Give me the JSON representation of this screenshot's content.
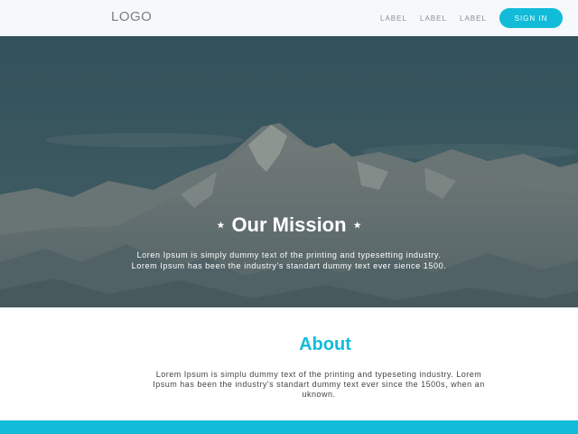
{
  "header": {
    "logo": "LOGO",
    "nav": [
      "LABEL",
      "LABEL",
      "LABEL"
    ],
    "signin_label": "SIGN IN"
  },
  "hero": {
    "title": "Our Mission",
    "star_glyph": "★",
    "text_line1": "Loren Ipsum is simply dummy text of the printing and typesetting industry.",
    "text_line2": "Lorem Ipsum has been the industry's standart dummy text ever sience 1500."
  },
  "about": {
    "title": "About",
    "text": "Lorem Ipsum is simplu dummy text of the printing and typeseting industry. Lorem Ipsum has been the industry's standart dummy text ever since the 1500s, when an uknown."
  },
  "colors": {
    "accent": "#12bcd9",
    "navbar_bg": "#f5f9fc",
    "hero_overlay": "#38555f"
  }
}
